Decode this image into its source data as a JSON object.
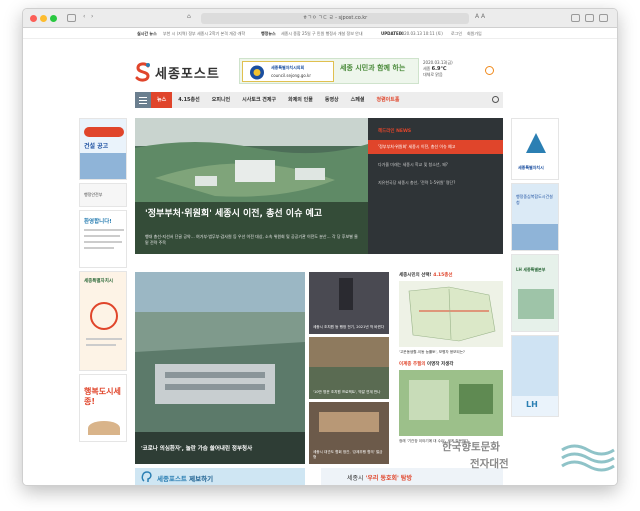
{
  "browser": {
    "url": "ㅎㄱㅇ ㄱㄷ ㄹ - sjpost.co.kr"
  },
  "ticker": {
    "label1": "실시간 뉴스",
    "text1": "부천 시 (지역) 정부 세종시 2학기 본격 개강·개학",
    "label2": "행정뉴스",
    "text2": "세종시 종합 25일 구 민원 행정사 개설 정보 안내",
    "updated_label": "UPDATED:",
    "updated_value": "2020.03.13 10:11 (토)",
    "links": [
      "로그인",
      "회원가입"
    ]
  },
  "header": {
    "logo": "세종포스트",
    "banner_council_line1": "세종특별자치시의회",
    "banner_council_line2": "council.sejong.go.kr",
    "banner_slogan": "세종 시민과 함께 하는",
    "weather_date": "2020.03.13(금)",
    "weather_city": "세종",
    "weather_temp": "6.9℃",
    "weather_desc": "대체로 맑음"
  },
  "nav": {
    "items": [
      "뉴스",
      "4.15총선",
      "오피니언",
      "시사토크 견제구",
      "화제의 인물",
      "동영상",
      "스페셜",
      "청렴이트홀"
    ]
  },
  "hero": {
    "title": "'정부부처·위원회' 세종시 이전, 총선 이슈 예고",
    "subtitle": "행대 총선-지선서 단골 공약… 여가부·법무부·감사원 등 우선 이전 대상, 소속 위원회 및 공공기관 이전도 분산… 각 당 후보별 물밑 전략 주목",
    "news_label": "헤드라인 NEWS",
    "news_items": [
      "'정부부처·위원회' 세종시 이전, 총선 이슈 예고",
      "다가올 미래는 세종시 학교 및 청소년, 왜?",
      "지유한국당 세종시 총선, '전략 1-5위원' 명단?"
    ]
  },
  "second": {
    "photo_title": "'코로나 의심환자', 놀란 가슴 쓸어내린 정부청사",
    "thumbs": [
      "세종시 조치원 등 행정 전기, 2021년 착 바뀐다",
      "'10만 명운 조치원 프로젝트', 막말 연계 반나",
      "세종시 대관도 협회 정관, '강제추행 협의' 벌금형"
    ],
    "side_head_pre": "세종시민의 선택!",
    "side_head_red": "4.15총선",
    "side_cap1": "'고운동생활-이동 능률토', 보병자 응모되는?",
    "side_head2_pre": "이계종 주필의",
    "side_head2_rest": "이명작 저생각",
    "side_cap2": "정래 '기관장 이야기에 대 수요', 세게 질문하다"
  },
  "left_ads": [
    "건설 공고",
    "행정안전부",
    "환영합니다!",
    "세종특별자치시",
    "행복도시세종!"
  ],
  "right_ads": [
    "세종특별자치시",
    "행정중심복합도시건설청",
    "LH 세종특별본부",
    "LH"
  ],
  "bottom": {
    "report_pre": "세종포스트",
    "report_bold": "제보하기",
    "slogan_pre": "세종시",
    "slogan_mid": "'우리 동호회' 탐방",
    "slogan_red": "작"
  },
  "watermark": {
    "line1": "한국향토문화",
    "line2": "전자대전"
  },
  "colors": {
    "accent": "#e0452b",
    "nav_bg": "#ededed",
    "dark_panel": "#2f3437"
  }
}
